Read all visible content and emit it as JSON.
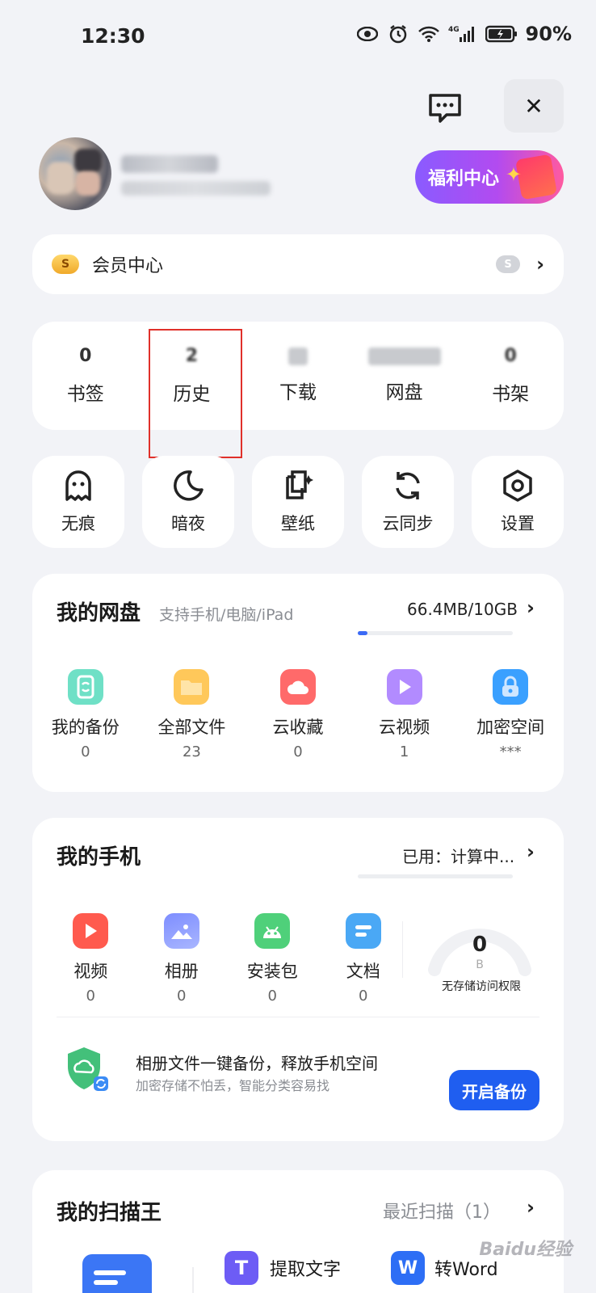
{
  "status_bar": {
    "time": "12:30",
    "battery": "90%",
    "icons": [
      "eye-icon",
      "alarm-icon",
      "wifi-icon",
      "signal-4g-icon",
      "battery-icon"
    ]
  },
  "header": {
    "message_icon": "message-icon",
    "close_label": "✕",
    "welfare_label": "福利中心"
  },
  "member": {
    "label": "会员中心",
    "badge": "S",
    "cloud_badge": "S",
    "chevron": "›"
  },
  "stats": [
    {
      "value": "0",
      "label": "书签",
      "blur": false
    },
    {
      "value": "2",
      "label": "历史",
      "blur": true
    },
    {
      "value": "",
      "label": "下载",
      "blur": true
    },
    {
      "value": "",
      "label": "网盘",
      "blur": true
    },
    {
      "value": "0",
      "label": "书架",
      "blur": true
    }
  ],
  "tools": [
    {
      "label": "无痕",
      "icon": "ghost-icon"
    },
    {
      "label": "暗夜",
      "icon": "moon-icon"
    },
    {
      "label": "壁纸",
      "icon": "wallpaper-icon"
    },
    {
      "label": "云同步",
      "icon": "sync-icon"
    },
    {
      "label": "设置",
      "icon": "settings-icon"
    }
  ],
  "disk": {
    "title": "我的网盘",
    "subtitle": "支持手机/电脑/iPad",
    "usage": "66.4MB/10GB",
    "usage_fraction": 0.0065,
    "chevron": "›",
    "items": [
      {
        "label": "我的备份",
        "value": "0",
        "icon": "backup-icon",
        "color": "#5fd1b8"
      },
      {
        "label": "全部文件",
        "value": "23",
        "icon": "folder-icon",
        "color": "#ffc34d"
      },
      {
        "label": "云收藏",
        "value": "0",
        "icon": "cloud-favorite-icon",
        "color": "#ff6b6b"
      },
      {
        "label": "云视频",
        "value": "1",
        "icon": "cloud-video-icon",
        "color": "#a87bff"
      },
      {
        "label": "加密空间",
        "value": "***",
        "icon": "lock-icon",
        "color": "#3aa0ff"
      }
    ]
  },
  "phone": {
    "title": "我的手机",
    "used_label": "已用：计算中...",
    "chevron": "›",
    "items": [
      {
        "label": "视频",
        "value": "0",
        "icon": "video-icon",
        "color": "#ff5a4e"
      },
      {
        "label": "相册",
        "value": "0",
        "icon": "album-icon",
        "color": "#7a8cff"
      },
      {
        "label": "安装包",
        "value": "0",
        "icon": "android-icon",
        "color": "#4fd07a"
      },
      {
        "label": "文档",
        "value": "0",
        "icon": "document-icon",
        "color": "#4aa8f5"
      }
    ],
    "gauge_value": "0",
    "gauge_unit": "B",
    "gauge_note": "无存储访问权限",
    "backup_title": "相册文件一键备份，释放手机空间",
    "backup_sub": "加密存储不怕丢，智能分类容易找",
    "backup_button": "开启备份"
  },
  "scan": {
    "title": "我的扫描王",
    "recent": "最近扫描（1）",
    "chevron": "›",
    "actions": [
      {
        "label": "提取文字",
        "icon": "text-extract-icon",
        "color": "#6d5cf5",
        "glyph": "T"
      },
      {
        "label": "转Word",
        "icon": "word-icon",
        "color": "#2d6ef5",
        "glyph": "W"
      }
    ]
  },
  "watermark": "Baidu经验"
}
